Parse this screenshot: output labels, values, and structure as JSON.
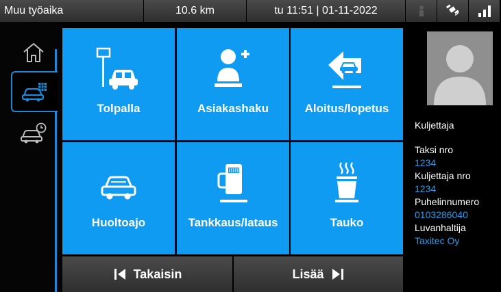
{
  "status_bar": {
    "mode": "Muu työaika",
    "distance": "10.6 km",
    "datetime": "tu 11:51 | 01-11-2022",
    "icons": [
      "driver-icon",
      "satellite-icon",
      "signal-icon"
    ]
  },
  "nav": {
    "items": [
      {
        "name": "home-icon"
      },
      {
        "name": "taxi-menu-icon",
        "active": true
      },
      {
        "name": "taxi-history-icon"
      }
    ]
  },
  "tiles": [
    {
      "label": "Tolpalla",
      "icon": "taxi-stand-icon"
    },
    {
      "label": "Asiakashaku",
      "icon": "add-customer-icon"
    },
    {
      "label": "Aloitus/lopetus",
      "icon": "start-stop-icon"
    },
    {
      "label": "Huoltoajo",
      "icon": "car-icon"
    },
    {
      "label": "Tankkaus/lataus",
      "icon": "fuel-pump-icon"
    },
    {
      "label": "Tauko",
      "icon": "coffee-cup-icon"
    }
  ],
  "bottom": {
    "back_label": "Takaisin",
    "more_label": "Lisää"
  },
  "driver": {
    "title": "Kuljettaja",
    "taxi_label": "Taksi nro",
    "taxi_value": "1234",
    "driver_label": "Kuljettaja nro",
    "driver_value": "1234",
    "phone_label": "Puhelinnumero",
    "phone_value": "0103286040",
    "licence_label": "Luvanhaltija",
    "licence_value": "Taxitec Oy"
  },
  "colors": {
    "tile": "#109bf3",
    "accent": "#1e88d6",
    "value_text": "#2a9ee8"
  }
}
